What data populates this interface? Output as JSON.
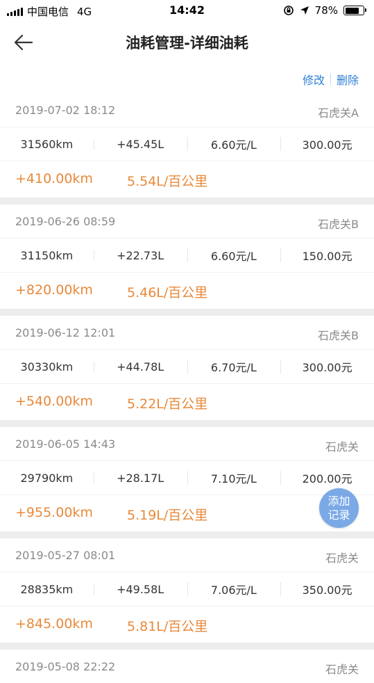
{
  "status_bar": {
    "carrier": "中国电信",
    "network": "4G",
    "time": "14:42",
    "battery": "78%",
    "battery_level": 0.78
  },
  "nav": {
    "title": "油耗管理-详细油耗"
  },
  "actions": {
    "edit": "修改",
    "delete": "删除"
  },
  "colors": {
    "accent_blue": "#2f7fd6",
    "orange": "#e8893a",
    "fab": "#7aa9e6"
  },
  "records": [
    {
      "datetime": "2019-07-02 18:12",
      "station": "石虎关A",
      "odometer": "31560km",
      "fuel": "+45.45L",
      "price": "6.60元/L",
      "amount": "300.00元",
      "distance": "+410.00km",
      "consumption": "5.54L/百公里"
    },
    {
      "datetime": "2019-06-26 08:59",
      "station": "石虎关B",
      "odometer": "31150km",
      "fuel": "+22.73L",
      "price": "6.60元/L",
      "amount": "150.00元",
      "distance": "+820.00km",
      "consumption": "5.46L/百公里"
    },
    {
      "datetime": "2019-06-12 12:01",
      "station": "石虎关B",
      "odometer": "30330km",
      "fuel": "+44.78L",
      "price": "6.70元/L",
      "amount": "300.00元",
      "distance": "+540.00km",
      "consumption": "5.22L/百公里"
    },
    {
      "datetime": "2019-06-05 14:43",
      "station": "石虎关",
      "odometer": "29790km",
      "fuel": "+28.17L",
      "price": "7.10元/L",
      "amount": "200.00元",
      "distance": "+955.00km",
      "consumption": "5.19L/百公里"
    },
    {
      "datetime": "2019-05-27 08:01",
      "station": "石虎关",
      "odometer": "28835km",
      "fuel": "+49.58L",
      "price": "7.06元/L",
      "amount": "350.00元",
      "distance": "+845.00km",
      "consumption": "5.81L/百公里"
    },
    {
      "datetime": "2019-05-08 22:22",
      "station": "石虎关"
    }
  ],
  "fab": {
    "line1": "添加",
    "line2": "记录"
  }
}
